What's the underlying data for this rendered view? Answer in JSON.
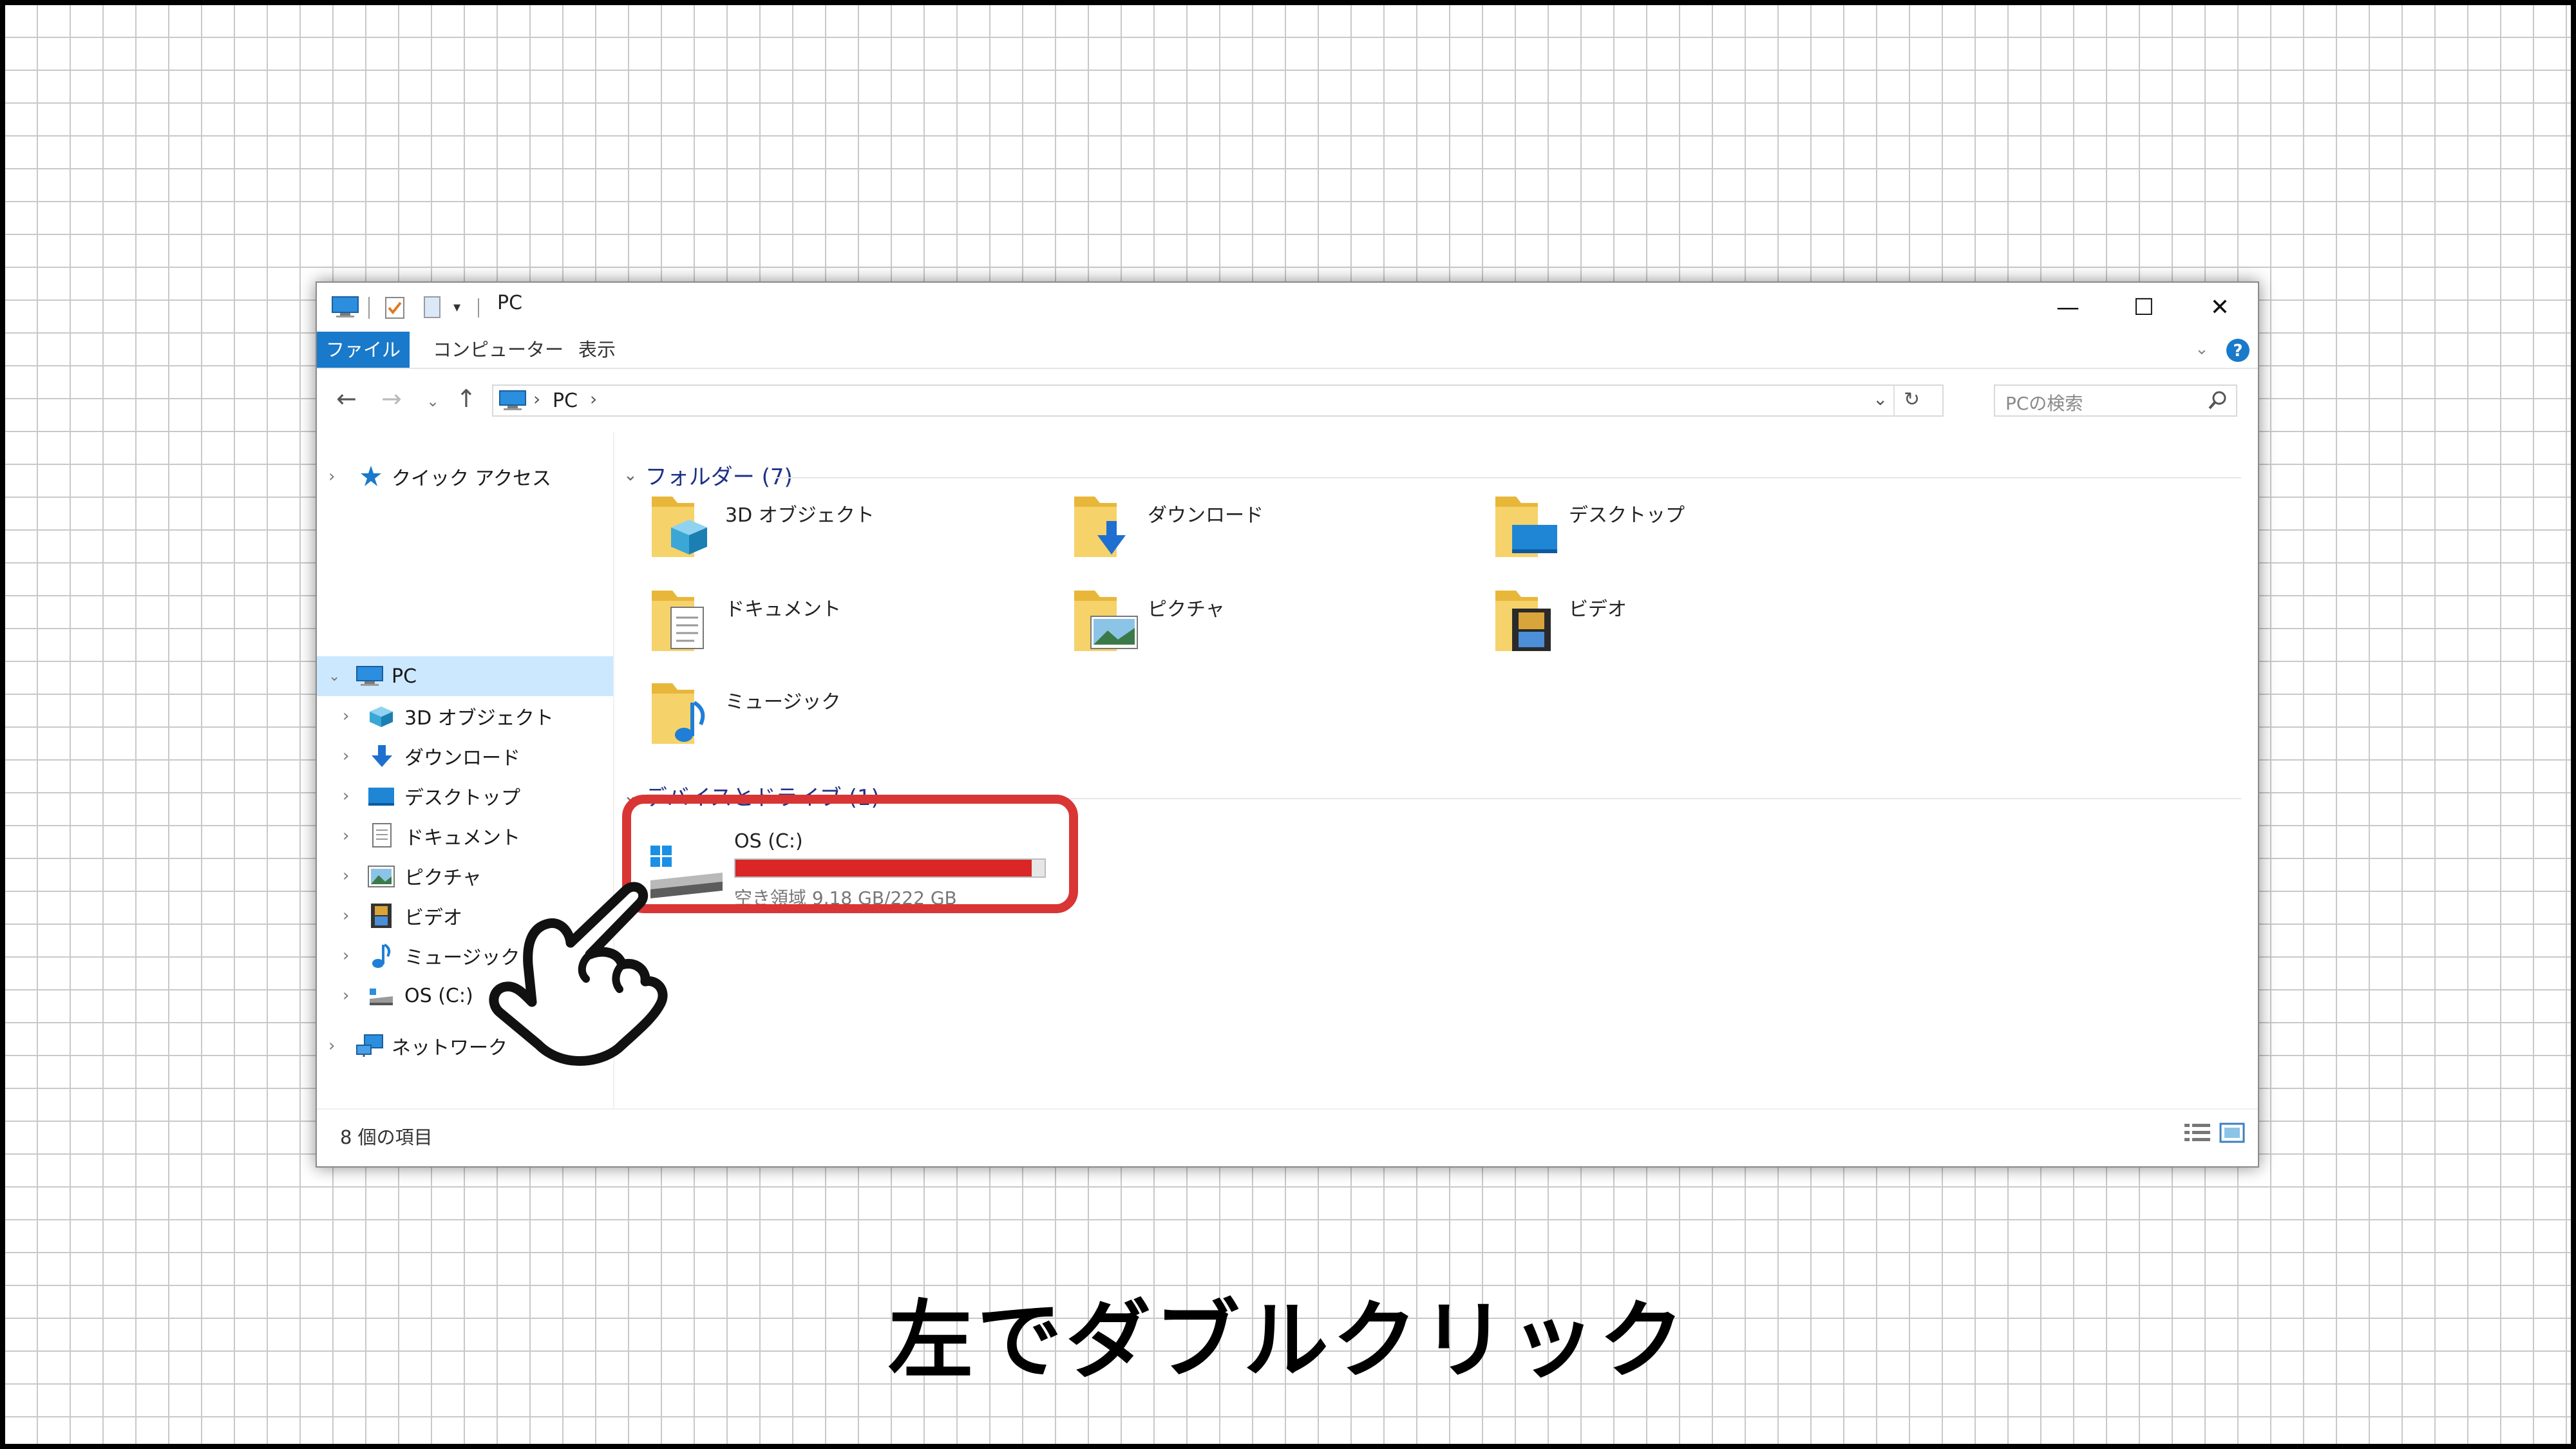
{
  "window": {
    "title": "PC",
    "tabs": [
      "ファイル",
      "コンピューター",
      "表示"
    ],
    "controls": {
      "minimize": "—",
      "maximize": "☐",
      "close": "✕"
    }
  },
  "address": {
    "crumb_root": "PC",
    "search_placeholder": "PCの検索"
  },
  "sidebar": {
    "quick_access": "クイック アクセス",
    "pc": "PC",
    "items": [
      "3D オブジェクト",
      "ダウンロード",
      "デスクトップ",
      "ドキュメント",
      "ピクチャ",
      "ビデオ",
      "ミュージック",
      "OS (C:)"
    ],
    "network": "ネットワーク"
  },
  "folders": {
    "header": "フォルダー (7)",
    "items": [
      "3D オブジェクト",
      "ダウンロード",
      "デスクトップ",
      "ドキュメント",
      "ピクチャ",
      "ビデオ",
      "ミュージック"
    ]
  },
  "drives": {
    "header": "デバイスとドライブ (1)",
    "items": [
      {
        "name": "OS (C:)",
        "free_text": "空き領域 9.18 GB/222 GB",
        "used_fraction": 0.959,
        "bar_color": "#da2626"
      }
    ]
  },
  "status": {
    "count": "8 個の項目"
  },
  "highlight_color": "#d93535",
  "caption": "左でダブルクリック"
}
